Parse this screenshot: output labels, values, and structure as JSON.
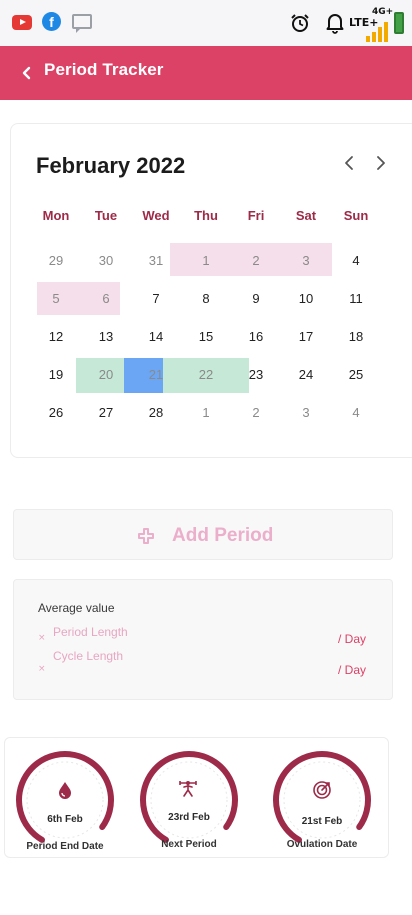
{
  "colors": {
    "brand": "#dc4266",
    "weekday": "#9c2a48",
    "period_pink": "#f5dfea",
    "fertile_green": "#c6e8d6",
    "ovulation_blue": "#6aa6f3",
    "gauge": "#9c2a48"
  },
  "status_bar": {
    "icons": [
      "youtube-icon",
      "facebook-icon",
      "chat-icon",
      "alarm-icon",
      "bell-icon",
      "signal-icon",
      "battery-icon"
    ],
    "facebook_glyph": "f",
    "lte": "LTE+",
    "network": "4G+"
  },
  "appbar": {
    "title": "Period Tracker"
  },
  "calendar": {
    "month_title": "February 2022",
    "weekdays": [
      "Mon",
      "Tue",
      "Wed",
      "Thu",
      "Fri",
      "Sat",
      "Sun"
    ],
    "weeks": [
      [
        "29",
        "30",
        "31",
        "1",
        "2",
        "3",
        "4"
      ],
      [
        "5",
        "6",
        "7",
        "8",
        "9",
        "10",
        "11"
      ],
      [
        "12",
        "13",
        "14",
        "15",
        "16",
        "17",
        "18"
      ],
      [
        "19",
        "20",
        "21",
        "22",
        "23",
        "24",
        "25"
      ],
      [
        "26",
        "27",
        "28",
        "1",
        "2",
        "3",
        "4"
      ]
    ]
  },
  "add_period": {
    "label": "Add Period"
  },
  "average": {
    "heading": "Average value",
    "rows": [
      {
        "mark": "×",
        "label": "Period Length",
        "value": "/ Day"
      },
      {
        "mark": "×",
        "label": "Cycle Length",
        "value": "/ Day"
      }
    ]
  },
  "stats": [
    {
      "icon": "drop-icon",
      "value": "6th Feb",
      "label": "Period End Date",
      "progress": 0.92
    },
    {
      "icon": "weightlifter-icon",
      "value": "23rd Feb",
      "label": "Next Period",
      "progress": 0.92
    },
    {
      "icon": "target-icon",
      "value": "21st Feb",
      "label": "Ovulation Date",
      "progress": 0.92
    }
  ]
}
